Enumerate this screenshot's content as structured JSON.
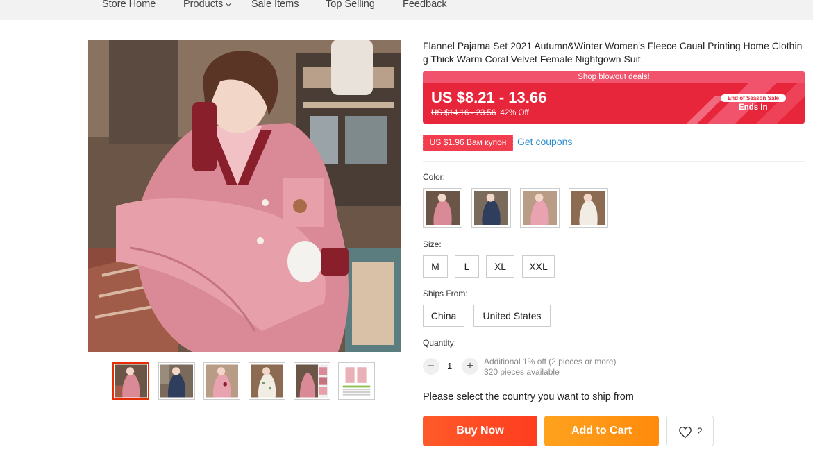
{
  "nav": {
    "items": [
      "Store Home",
      "Products",
      "Sale Items",
      "Top Selling",
      "Feedback"
    ]
  },
  "product": {
    "title": "Flannel Pajama Set 2021 Autumn&Winter Women's Fleece Caual Printing Home Clothing Thick Warm Coral Velvet Female Nightgown Suit"
  },
  "promo": {
    "banner_text": "Shop blowout deals!",
    "price_range": "US $8.21 - 13.66",
    "original_price": "US $14.16 - 23.56",
    "discount": "42% Off",
    "sale_badge": "End of Season Sale",
    "ends_in": "Ends In",
    "colors": {
      "banner": "#e8263b",
      "banner_top": "#f0536b"
    }
  },
  "coupon": {
    "label": "US $1.96 Вам купон",
    "link": "Get coupons"
  },
  "options": {
    "color_label": "Color:",
    "colors": [
      "pink-pajama-thumb",
      "navy-pajama-thumb",
      "pink-bear-pajama-thumb",
      "cream-print-pajama-thumb"
    ],
    "size_label": "Size:",
    "sizes": [
      "M",
      "L",
      "XL",
      "XXL"
    ],
    "ships_label": "Ships From:",
    "ships_from": [
      "China",
      "United States"
    ],
    "quantity_label": "Quantity:",
    "quantity_value": "1",
    "minus": "−",
    "plus": "+",
    "qty_note1": "Additional 1% off (2 pieces or more)",
    "qty_note2": "320 pieces available"
  },
  "shipping_message": "Please select the country you want to ship from",
  "actions": {
    "buy_now": "Buy Now",
    "add_to_cart": "Add to Cart",
    "wishlist_count": "2",
    "colors": {
      "buy": "#ff4a24",
      "cart": "#ff9a14"
    }
  },
  "gallery": {
    "thumbnails": [
      "pink-pajama-thumb",
      "navy-pajama-thumb",
      "pink-bear-pajama-thumb",
      "cream-print-pajama-thumb",
      "pink-detail-thumb",
      "size-chart-thumb"
    ]
  }
}
